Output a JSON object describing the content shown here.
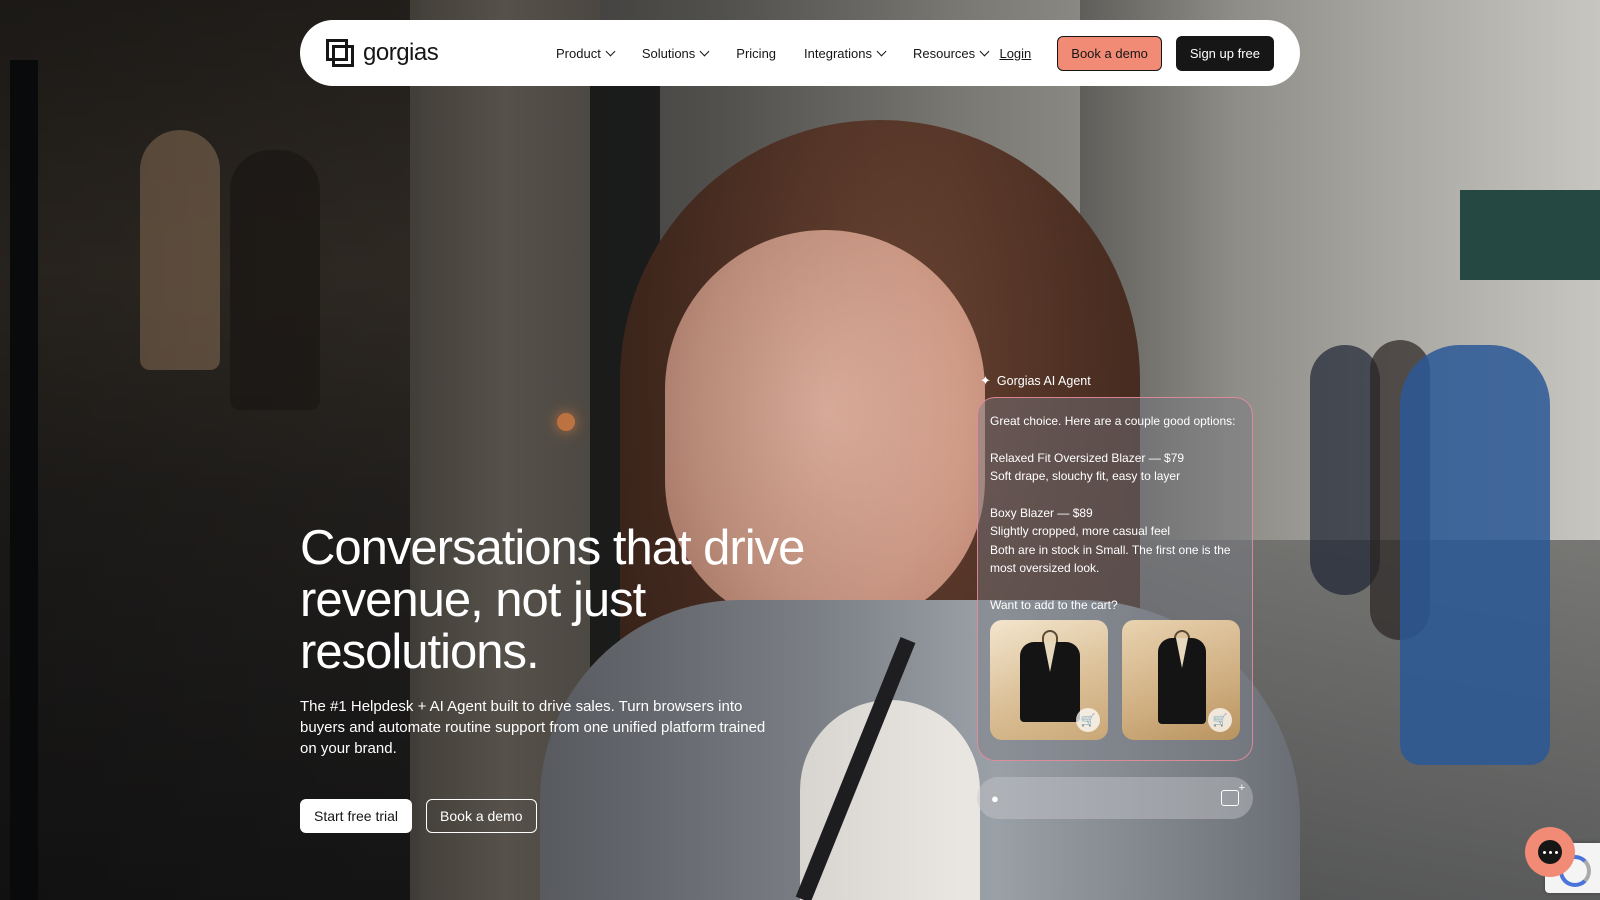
{
  "nav": {
    "logo_text": "gorgias",
    "items": [
      {
        "label": "Product",
        "has_dropdown": true
      },
      {
        "label": "Solutions",
        "has_dropdown": true
      },
      {
        "label": "Pricing",
        "has_dropdown": false
      },
      {
        "label": "Integrations",
        "has_dropdown": true
      },
      {
        "label": "Resources",
        "has_dropdown": true
      }
    ],
    "login_label": "Login",
    "book_demo_label": "Book a demo",
    "signup_label": "Sign up free"
  },
  "hero": {
    "title": "Conversations that drive revenue, not just resolutions.",
    "subtitle": "The #1 Helpdesk + AI Agent built to drive sales. Turn browsers into buyers and automate routine support from one unified platform trained on your brand.",
    "cta_primary": "Start free trial",
    "cta_secondary": "Book a demo"
  },
  "agent": {
    "label": "Gorgias AI Agent",
    "intro": "Great choice. Here are a couple good options:",
    "option1_title": "Relaxed Fit Oversized Blazer — $79",
    "option1_desc": "Soft drape, slouchy fit, easy to layer",
    "option2_title": "Boxy Blazer — $89",
    "option2_desc": "Slightly cropped, more casual feel",
    "stock_note": "Both are in stock in Small. The first one is the most oversized look.",
    "question": "Want to add to the cart?",
    "products": [
      {
        "name": "Relaxed Fit Oversized Blazer",
        "icon": "cart-icon"
      },
      {
        "name": "Boxy Blazer",
        "icon": "cart-icon"
      }
    ]
  },
  "colors": {
    "accent": "#f28b75",
    "dark": "#161616",
    "chat_border": "#ec8ca0"
  }
}
